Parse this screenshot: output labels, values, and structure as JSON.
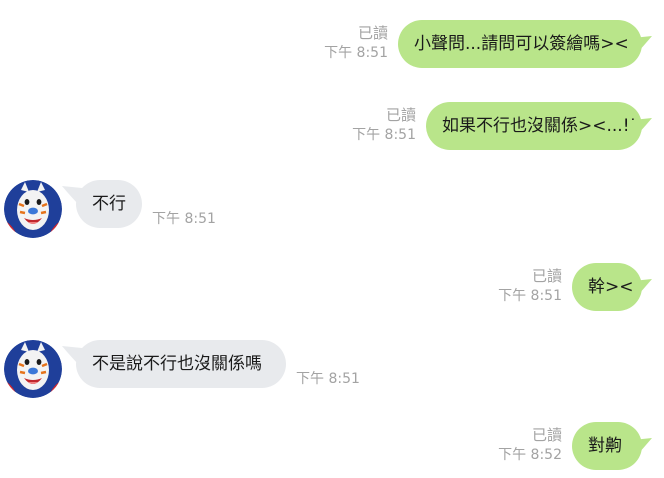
{
  "messages": [
    {
      "side": "out",
      "text": "小聲問...請問可以簽繪嗎><",
      "read": "已讀",
      "time": "下午 8:51"
    },
    {
      "side": "out",
      "text": "如果不行也沒關係><...!!",
      "read": "已讀",
      "time": "下午 8:51"
    },
    {
      "side": "in",
      "text": "不行",
      "time": "下午 8:51"
    },
    {
      "side": "out",
      "text": "幹><",
      "read": "已讀",
      "time": "下午 8:51"
    },
    {
      "side": "in",
      "text": "不是說不行也沒關係嗎",
      "time": "下午 8:51"
    },
    {
      "side": "out",
      "text": "對齁",
      "read": "已讀",
      "time": "下午 8:52"
    }
  ],
  "colors": {
    "outgoing_bubble": "#b9e58a",
    "incoming_bubble": "#e8eaed",
    "meta_text": "#a3a3a3"
  },
  "avatar_icon": "tiger-mascot-avatar"
}
